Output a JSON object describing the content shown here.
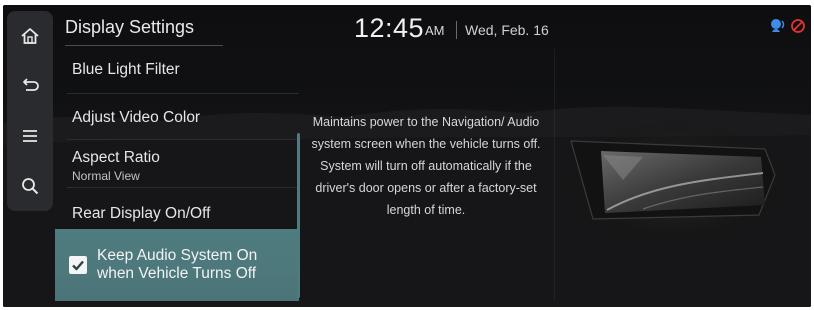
{
  "header": {
    "title": "Display Settings",
    "time": "12:45",
    "ampm": "AM",
    "date": "Wed, Feb. 16"
  },
  "rail": {
    "items": [
      {
        "icon": "home-icon"
      },
      {
        "icon": "back-icon"
      },
      {
        "icon": "menu-icon"
      },
      {
        "icon": "search-icon"
      }
    ]
  },
  "status_icons": [
    "voice-recognition-icon",
    "no-connection-icon"
  ],
  "menu": {
    "items": [
      {
        "label": "Blue Light Filter"
      },
      {
        "label": "Adjust Video Color"
      },
      {
        "label": "Aspect Ratio",
        "sublabel": "Normal View"
      },
      {
        "label": "Rear Display On/Off"
      }
    ],
    "selected": {
      "label_line1": "Keep Audio System On",
      "label_line2": "when Vehicle Turns Off",
      "checked": true
    }
  },
  "description": "Maintains power to the Navigation/ Audio system screen when the vehicle turns off. System will turn off automatically if the driver's door opens or after a factory-set length of time.",
  "colors": {
    "background": "#111113",
    "rail": "#2a2b2e",
    "selected_item": "#4f7c80",
    "scrollbar": "#4e7a80",
    "status_red": "#e0332d",
    "status_blue": "#3f8ce8"
  }
}
